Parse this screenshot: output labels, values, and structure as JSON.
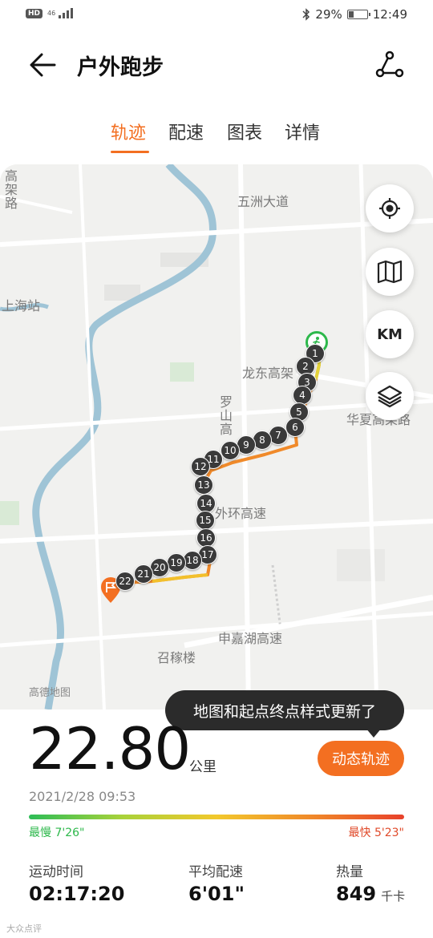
{
  "status_bar": {
    "hd": "HD",
    "network": "46",
    "battery_text": "29%",
    "battery_level": 0.29,
    "time": "12:49"
  },
  "header": {
    "title": "户外跑步",
    "back_icon": "back-arrow-icon",
    "route_icon": "route-share-icon"
  },
  "tabs": [
    {
      "label": "轨迹",
      "active": true
    },
    {
      "label": "配速",
      "active": false
    },
    {
      "label": "图表",
      "active": false
    },
    {
      "label": "详情",
      "active": false
    }
  ],
  "map": {
    "labels": {
      "wuzhou": "五洲大道",
      "shanghai_station": "上海站",
      "gaojia": "高架路",
      "longdong": "龙东高架",
      "luoshan": "罗山高",
      "huaxia": "华夏高架路",
      "waihuan": "外环高速",
      "shenjiahu": "申嘉湖高速",
      "zhaojialou": "召稼楼"
    },
    "credit": "高德地图",
    "controls": {
      "locate_icon": "locate-icon",
      "map_icon": "map-icon",
      "km_label": "KM",
      "layers_icon": "layers-icon"
    },
    "km_markers": [
      "1",
      "2",
      "3",
      "4",
      "5",
      "6",
      "7",
      "8",
      "9",
      "10",
      "11",
      "12",
      "13",
      "14",
      "15",
      "16",
      "17",
      "18",
      "19",
      "20",
      "21",
      "22"
    ],
    "start_icon": "runner-icon",
    "end_icon": "finish-flag-icon"
  },
  "tooltip": "地图和起点终点样式更新了",
  "summary": {
    "distance": "22.80",
    "distance_unit": "公里",
    "dynamic_button": "动态轨迹",
    "datetime": "2021/2/28 09:53",
    "slowest": "最慢 7'26\"",
    "fastest": "最快 5'23\""
  },
  "stats": {
    "duration_label": "运动时间",
    "duration_value": "02:17:20",
    "pace_label": "平均配速",
    "pace_value": "6'01\"",
    "calories_label": "热量",
    "calories_value": "849",
    "calories_unit": "千卡"
  },
  "watermark": "大众点评"
}
